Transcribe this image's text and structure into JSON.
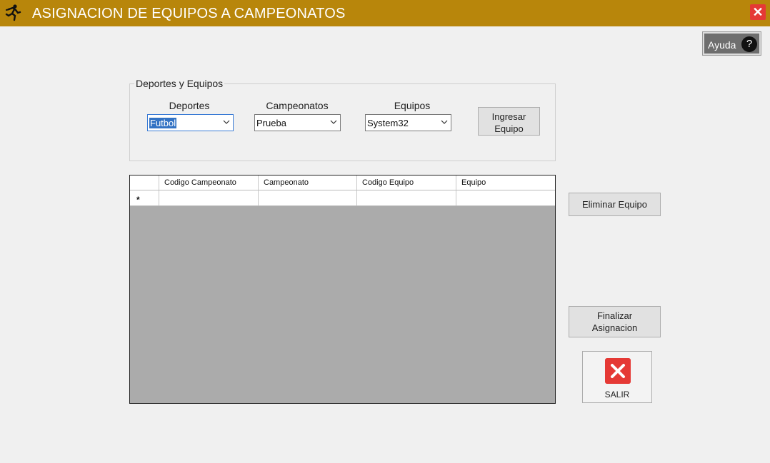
{
  "window": {
    "title": "ASIGNACION DE EQUIPOS A CAMPEONATOS",
    "app_icon": "runner-icon",
    "close_glyph": "✕"
  },
  "help": {
    "label": "Ayuda",
    "icon_glyph": "?"
  },
  "filters": {
    "group_title": "Deportes y Equipos",
    "deportes": {
      "label": "Deportes",
      "value": "Futbol"
    },
    "campeonatos": {
      "label": "Campeonatos",
      "value": "Prueba"
    },
    "equipos": {
      "label": "Equipos",
      "value": "System32"
    },
    "ingresar_line1": "Ingresar",
    "ingresar_line2": "Equipo"
  },
  "grid": {
    "columns": [
      "Codigo Campeonato",
      "Campeonato",
      "Codigo Equipo",
      "Equipo"
    ],
    "new_row_marker": "*"
  },
  "actions": {
    "eliminar": "Eliminar Equipo",
    "finalizar_line1": "Finalizar",
    "finalizar_line2": "Asignacion",
    "salir": "SALIR"
  },
  "colors": {
    "titlebar": "#b8860b",
    "close": "#e53935",
    "grid_background": "#ababab"
  }
}
